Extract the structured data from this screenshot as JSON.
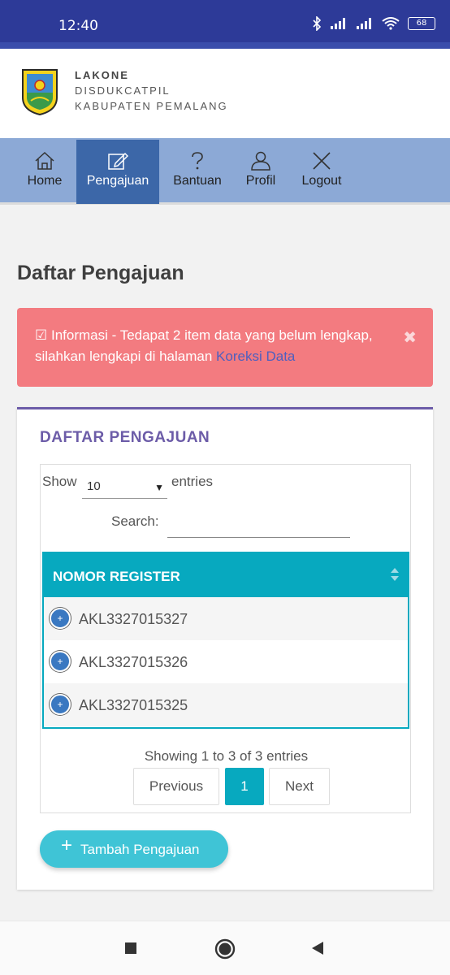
{
  "status": {
    "time": "12:40",
    "battery": "68"
  },
  "brand": {
    "line1": "LAKONE",
    "line2": "DISDUKCATPIL",
    "line3": "KABUPATEN PEMALANG"
  },
  "nav": [
    {
      "label": "Home",
      "icon": "home-icon"
    },
    {
      "label": "Pengajuan",
      "icon": "edit-icon",
      "active": true
    },
    {
      "label": "Bantuan",
      "icon": "question-icon"
    },
    {
      "label": "Profil",
      "icon": "user-icon"
    },
    {
      "label": "Logout",
      "icon": "close-icon"
    }
  ],
  "page_title": "Daftar Pengajuan",
  "alert": {
    "text": "Informasi - Tedapat 2 item data yang belum lengkap, silahkan lengkapi di halaman",
    "link": "Koreksi Data",
    "close": "✖",
    "color": "#f37b80"
  },
  "card": {
    "title": "DAFTAR PENGAJUAN",
    "show_label": "Show",
    "page_size": "10",
    "entries_label": "entries",
    "search_label": "Search:",
    "search_value": "",
    "column": "NOMOR REGISTER",
    "rows": [
      "AKL3327015327",
      "AKL3327015326",
      "AKL3327015325"
    ],
    "info": "Showing 1 to 3 of 3 entries",
    "prev": "Previous",
    "page": "1",
    "next": "Next",
    "add_button": "Tambah Pengajuan"
  },
  "colors": {
    "header": "#2d3a98",
    "nav": "#8ca9d6",
    "nav_active": "#3c67a8",
    "accent": "#07a9bf",
    "title": "#6c5ca8"
  }
}
